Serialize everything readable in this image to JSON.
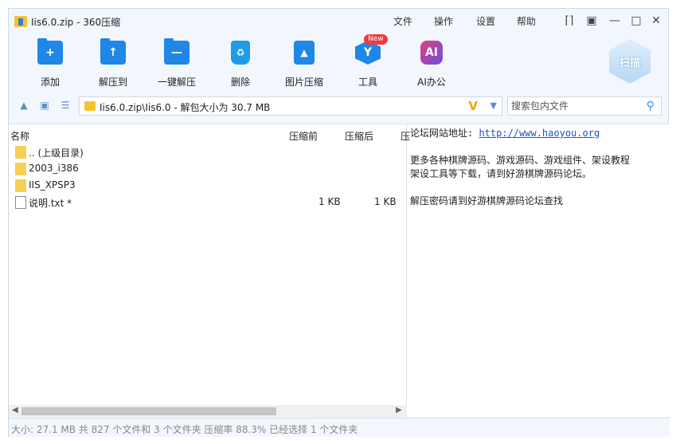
{
  "window": {
    "title": "Iis6.0.zip - 360压缩"
  },
  "menu": {
    "file": "文件",
    "operate": "操作",
    "settings": "设置",
    "help": "帮助"
  },
  "toolbar": {
    "add": "添加",
    "extract_to": "解压到",
    "one_click_extract": "一键解压",
    "delete": "删除",
    "image_compress": "图片压缩",
    "tools": "工具",
    "tools_badge": "New",
    "ai_office": "AI办公",
    "ai_icon_text": "AI",
    "scan": "扫描"
  },
  "address": {
    "path": "Iis6.0.zip\\Iis6.0 - 解包大小为 30.7 MB",
    "v_mark": "V"
  },
  "search": {
    "placeholder": "搜索包内文件"
  },
  "file_list": {
    "columns": {
      "name": "名称",
      "before": "压缩前",
      "after": "压缩后",
      "ratio": "压"
    },
    "rows": [
      {
        "name": ".. (上级目录)",
        "before": "",
        "after": "",
        "type": "folder"
      },
      {
        "name": "2003_i386",
        "before": "",
        "after": "",
        "type": "folder"
      },
      {
        "name": "IIS_XPSP3",
        "before": "",
        "after": "",
        "type": "folder"
      },
      {
        "name": "说明.txt *",
        "before": "1 KB",
        "after": "1 KB",
        "type": "file"
      }
    ]
  },
  "preview": {
    "line1_label": "论坛网站地址: ",
    "line1_link": "http://www.haoyou.org",
    "line2": "更多各种棋牌源码、游戏源码、游戏组件、架设教程",
    "line3": "架设工具等下载，请到好游棋牌源码论坛。",
    "line4": "解压密码请到好游棋牌源码论坛查找"
  },
  "status": {
    "text": "大小: 27.1 MB 共 827 个文件和 3 个文件夹 压缩率 88.3% 已经选择 1 个文件夹"
  }
}
